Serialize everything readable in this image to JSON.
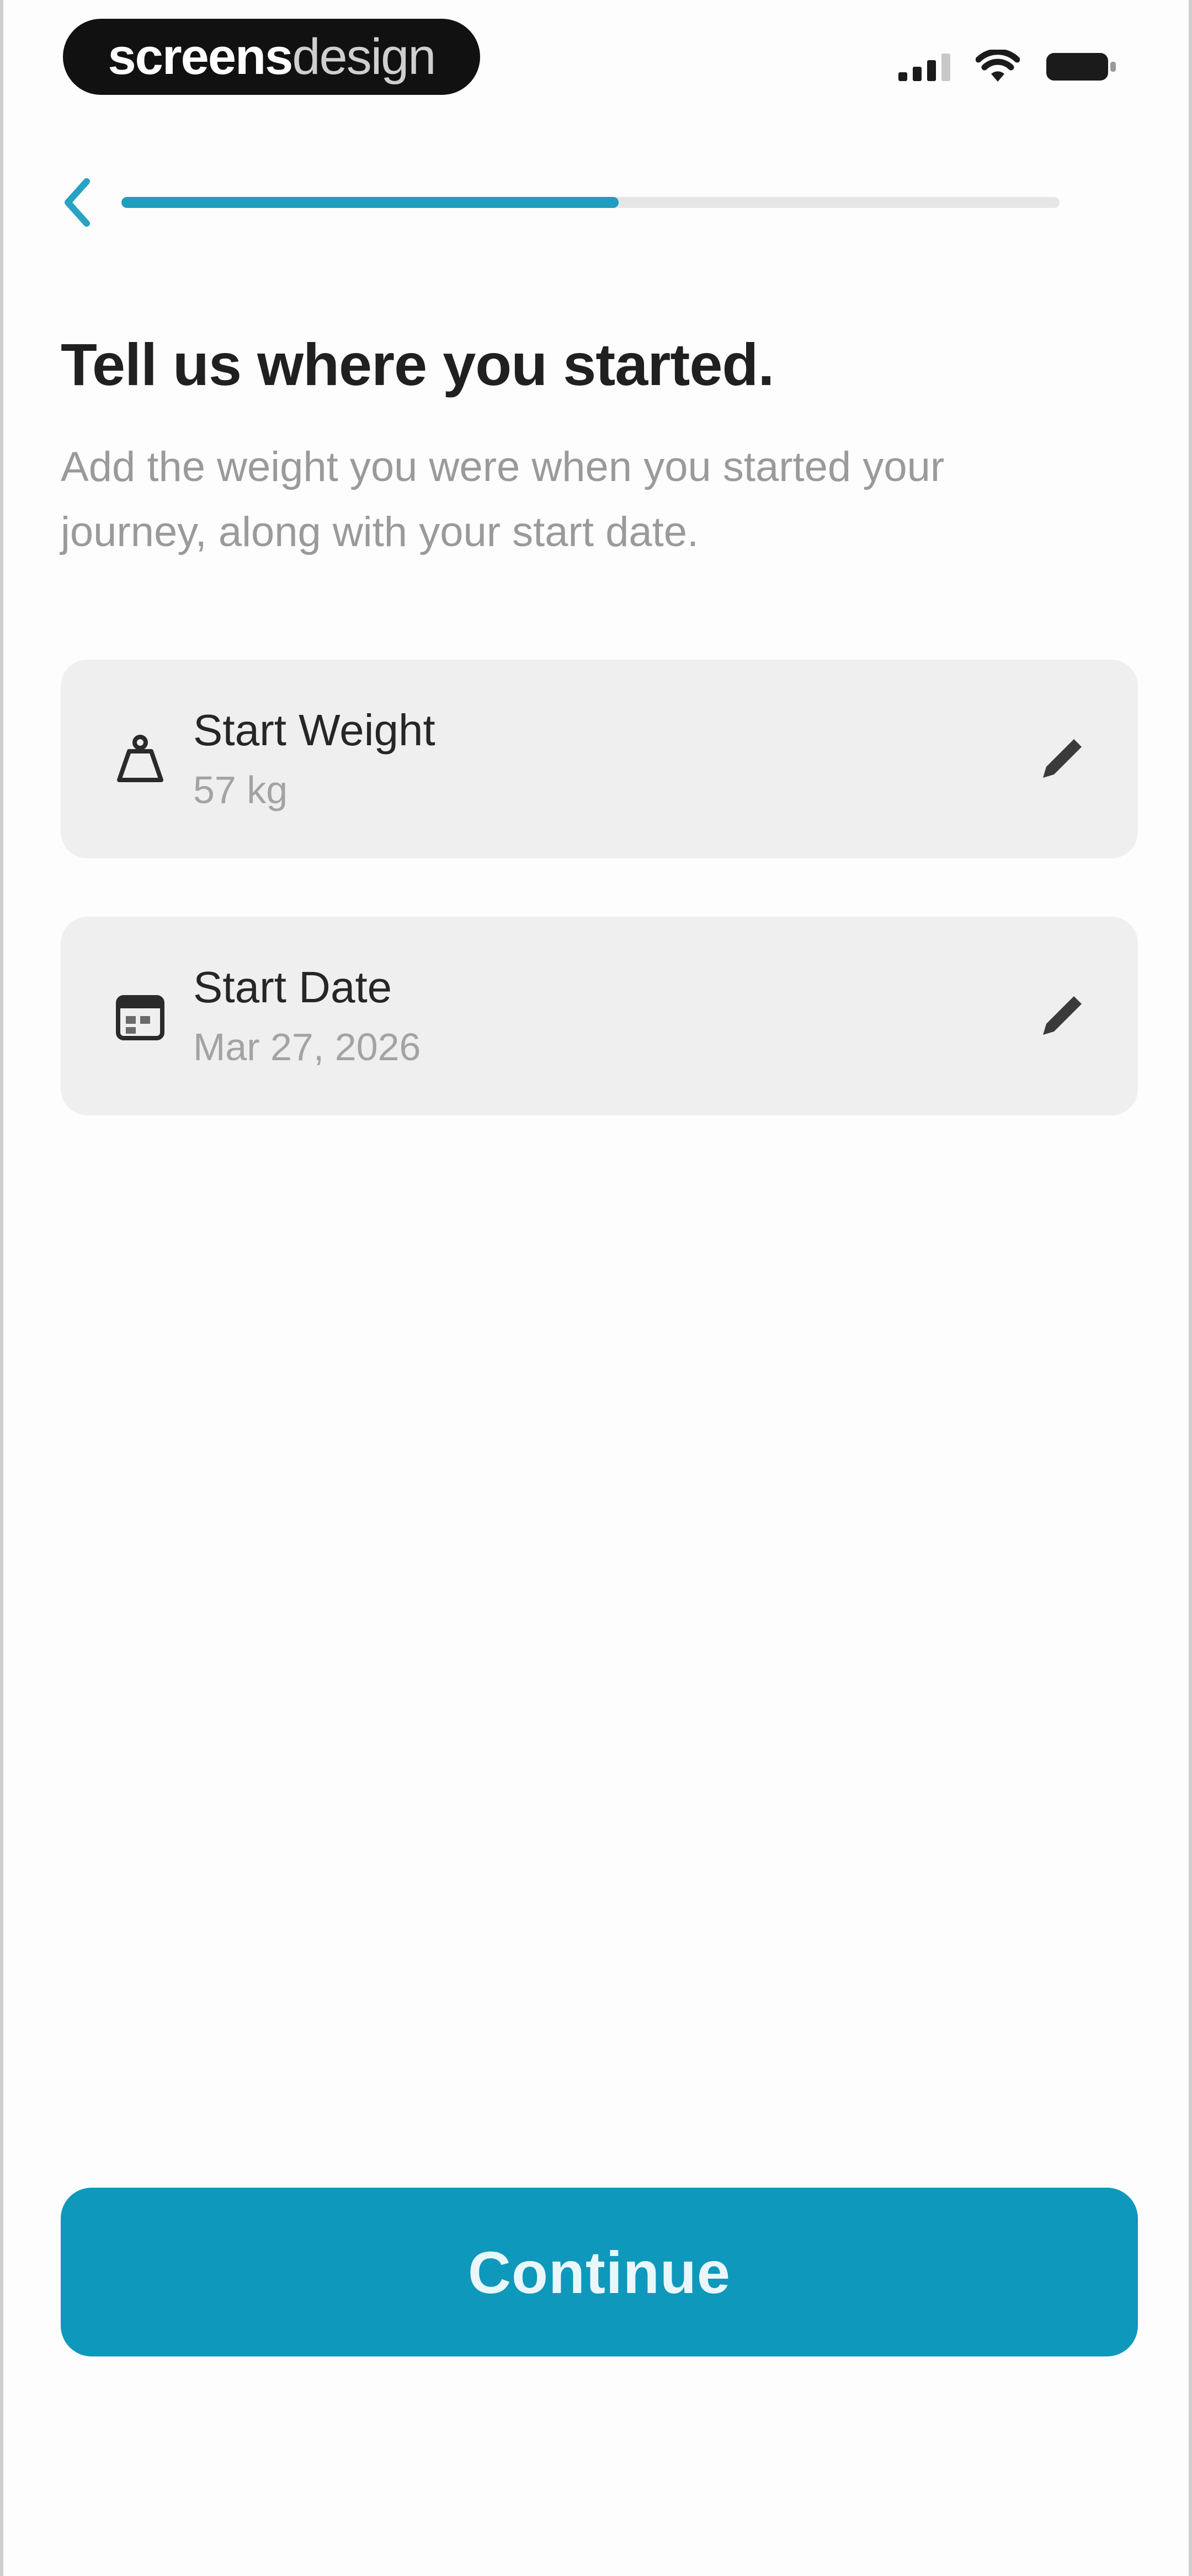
{
  "status_bar": {
    "logo_bold": "screens",
    "logo_light": "design",
    "icons": [
      "signal-icon",
      "wifi-icon",
      "battery-icon"
    ]
  },
  "header": {
    "back_icon": "chevron-left-icon",
    "progress": 0.53
  },
  "content": {
    "title": "Tell us where you started.",
    "subtitle": "Add the weight you were when you started your journey, along with your start date."
  },
  "fields": [
    {
      "label": "Start Weight",
      "value": "57 kg",
      "icon": "weight-icon",
      "action_icon": "pencil-icon"
    },
    {
      "label": "Start Date",
      "value": "Mar 27, 2026",
      "icon": "calendar-icon",
      "action_icon": "pencil-icon"
    }
  ],
  "footer": {
    "continue_label": "Continue"
  },
  "colors": {
    "accent": "#0e98bb",
    "progress": "#1f9dbf",
    "card_bg": "#efefef",
    "muted_text": "#9a9a9a"
  }
}
